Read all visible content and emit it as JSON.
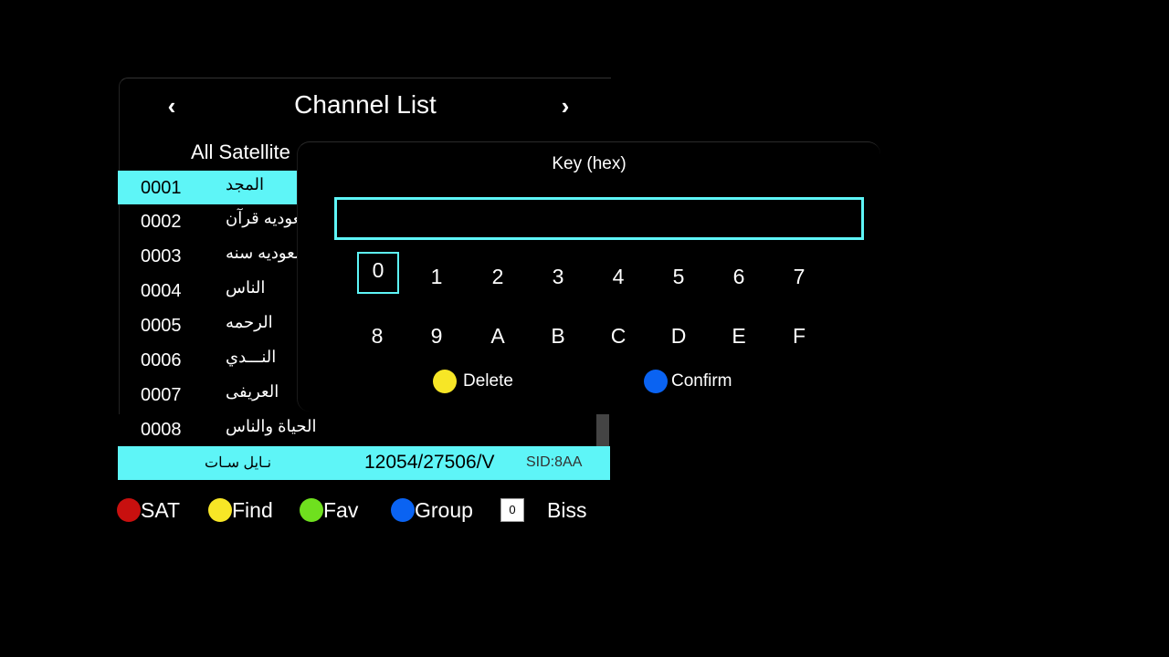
{
  "channel_list": {
    "title": "Channel List",
    "group": "All Satellite",
    "channels": [
      {
        "num": "0001",
        "name": "المجد"
      },
      {
        "num": "0002",
        "name": "السعوديه قرآن"
      },
      {
        "num": "0003",
        "name": "السعوديه سنه"
      },
      {
        "num": "0004",
        "name": "الناس"
      },
      {
        "num": "0005",
        "name": "الرحمه"
      },
      {
        "num": "0006",
        "name": "النـــدي"
      },
      {
        "num": "0007",
        "name": "العريفى"
      },
      {
        "num": "0008",
        "name": "الحياة والناس"
      }
    ]
  },
  "info_bar": {
    "satellite": "نـايل سـات",
    "frequency": "12054/27506/V",
    "sid": "SID:8AA"
  },
  "footer": {
    "sat": "SAT",
    "find": "Find",
    "fav": "Fav",
    "group": "Group",
    "key_value": "0",
    "biss": "Biss"
  },
  "dialog": {
    "title": "Key (hex)",
    "input_value": "",
    "keys_row1": [
      "0",
      "1",
      "2",
      "3",
      "4",
      "5",
      "6",
      "7"
    ],
    "keys_row2": [
      "8",
      "9",
      "A",
      "B",
      "C",
      "D",
      "E",
      "F"
    ],
    "delete_label": "Delete",
    "confirm_label": "Confirm"
  },
  "colors": {
    "highlight": "#5ef5f7",
    "red": "#c8100f",
    "yellow": "#f7e626",
    "green": "#6fe01e",
    "blue": "#0a63f2"
  }
}
